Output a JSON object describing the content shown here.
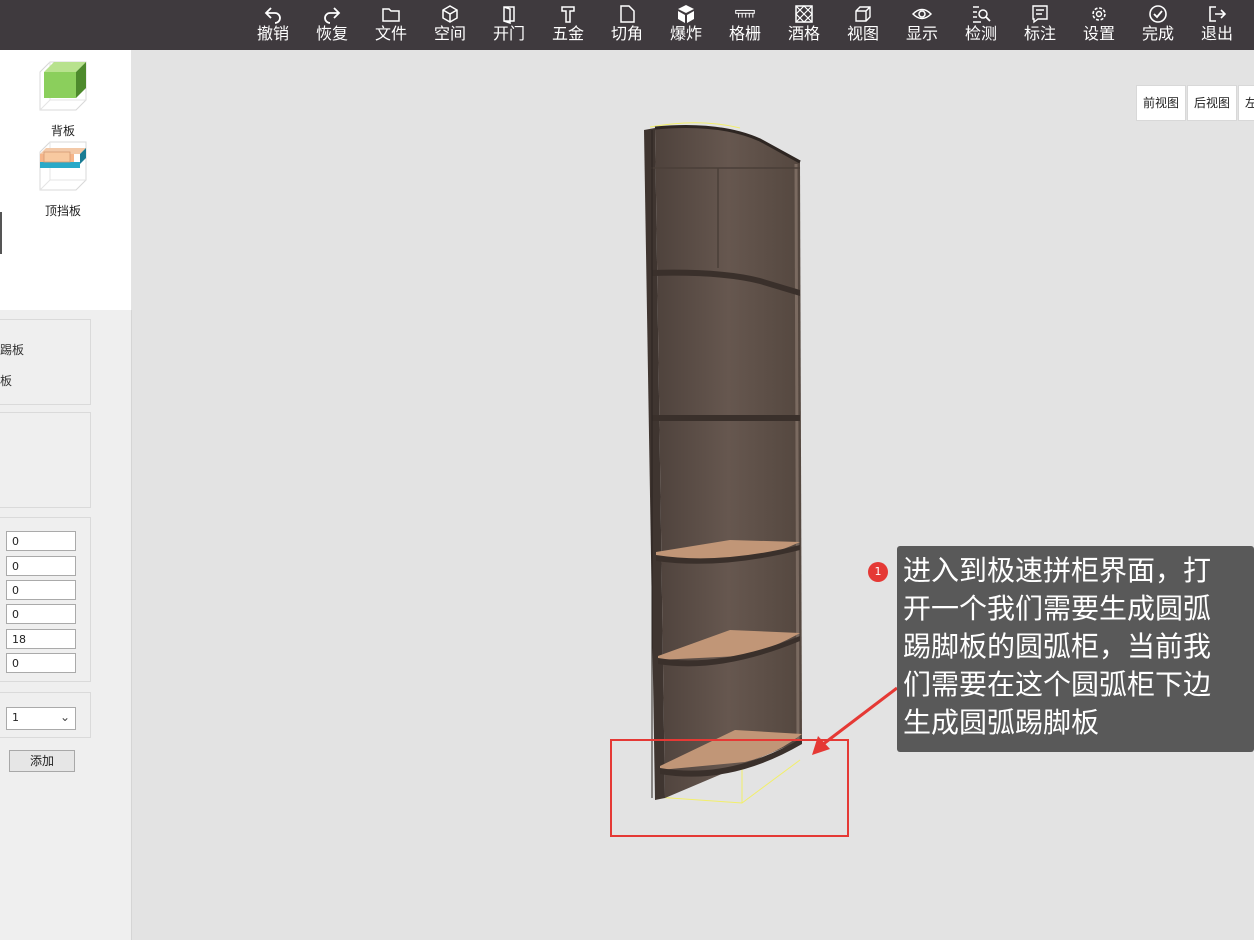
{
  "toolbar": {
    "items": [
      {
        "label": "撤销",
        "icon": "undo-icon"
      },
      {
        "label": "恢复",
        "icon": "redo-icon"
      },
      {
        "label": "文件",
        "icon": "folder-icon"
      },
      {
        "label": "空间",
        "icon": "cube-icon"
      },
      {
        "label": "开门",
        "icon": "door-icon"
      },
      {
        "label": "五金",
        "icon": "hardware-icon"
      },
      {
        "label": "切角",
        "icon": "corner-cut-icon"
      },
      {
        "label": "爆炸",
        "icon": "explode-icon"
      },
      {
        "label": "格栅",
        "icon": "grille-icon"
      },
      {
        "label": "酒格",
        "icon": "wine-rack-icon"
      },
      {
        "label": "视图",
        "icon": "view-icon"
      },
      {
        "label": "显示",
        "icon": "eye-icon"
      },
      {
        "label": "检测",
        "icon": "inspect-icon"
      },
      {
        "label": "标注",
        "icon": "annotate-icon"
      },
      {
        "label": "设置",
        "icon": "gear-icon"
      },
      {
        "label": "完成",
        "icon": "check-circle-icon"
      },
      {
        "label": "退出",
        "icon": "exit-icon"
      }
    ]
  },
  "parts": {
    "back_panel": "背板",
    "top_baffle": "顶挡板"
  },
  "left_panel": {
    "option1": "踢板",
    "option2": "板",
    "inputs": [
      "0",
      "0",
      "0",
      "0",
      "18",
      "0"
    ],
    "select_value": "1",
    "add_label": "添加"
  },
  "view_buttons": [
    "前视图",
    "后视图",
    "左"
  ],
  "callout": {
    "step": "1",
    "text": "进入到极速拼柜界面，打开一个我们需要生成圆弧踢脚板的圆弧柜，当前我们需要在这个圆弧柜下边生成圆弧踢脚板"
  },
  "colors": {
    "toolbar_bg": "#3f3a3e",
    "wood_dark": "#5e5048",
    "wood_light": "#b48a68",
    "highlight": "#e53935",
    "tip_bg": "#595959"
  }
}
